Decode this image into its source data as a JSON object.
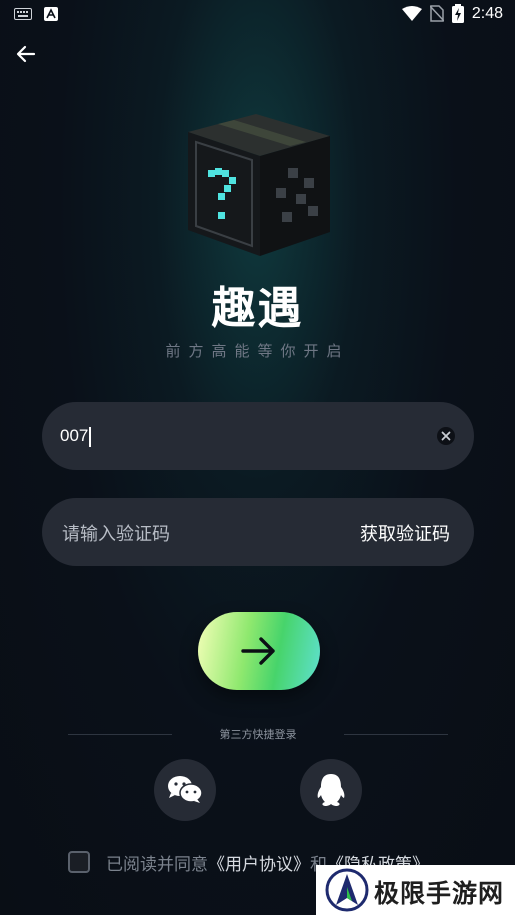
{
  "status_bar": {
    "time": "2:48",
    "left_icons": [
      "keyboard-icon",
      "app-notification-icon"
    ],
    "right_icons": [
      "wifi-icon",
      "no-sim-icon",
      "battery-charging-icon"
    ]
  },
  "header": {
    "back_icon": "arrow-left-icon"
  },
  "brand": {
    "logo": "mystery-cube-icon",
    "title": "趣遇",
    "slogan": "前方高能等你开启"
  },
  "form": {
    "phone": {
      "value": "007",
      "clear_icon": "clear-circle-icon"
    },
    "code": {
      "placeholder": "请输入验证码",
      "get_code_label": "获取验证码"
    },
    "submit_icon": "arrow-right-icon"
  },
  "third_party": {
    "label": "第三方快捷登录",
    "providers": [
      {
        "icon": "wechat-icon"
      },
      {
        "icon": "qq-icon"
      }
    ]
  },
  "agreement": {
    "checked": false,
    "prefix": "已阅读并同意",
    "user_agreement": "《用户协议》",
    "conjunction": "和",
    "privacy_policy": "《隐私政策》"
  },
  "watermark": {
    "text": "极限手游网",
    "logo": "site-logo-icon"
  },
  "colors": {
    "background": "#0a1019",
    "field": "#262b35",
    "accent_green": "#47d46b",
    "muted_text": "#7b828d"
  }
}
